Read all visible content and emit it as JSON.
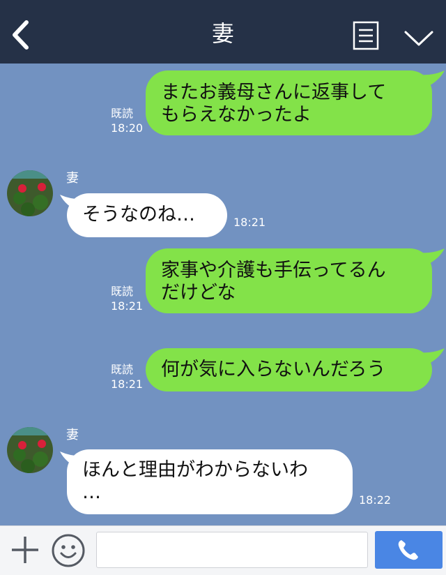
{
  "header": {
    "title": "妻",
    "back_icon": "chevron-left-icon",
    "menu_icon": "note-icon",
    "expand_icon": "chevron-down-icon"
  },
  "colors": {
    "header_bg": "#253147",
    "chat_bg": "#7292c1",
    "sent_bubble": "#83e249",
    "received_bubble": "#ffffff",
    "call_button": "#4a86e4"
  },
  "messages": [
    {
      "direction": "sent",
      "text": "またお義母さんに返事して\nもらえなかったよ",
      "read": "既読",
      "time": "18:20"
    },
    {
      "direction": "received",
      "sender": "妻",
      "text": "そうなのね…",
      "time": "18:21"
    },
    {
      "direction": "sent",
      "text": "家事や介護も手伝ってるん\nだけどな",
      "read": "既読",
      "time": "18:21"
    },
    {
      "direction": "sent",
      "text": "何が気に入らないんだろう",
      "read": "既読",
      "time": "18:21"
    },
    {
      "direction": "received",
      "sender": "妻",
      "text": "ほんと理由がわからないわ\n…",
      "time": "18:22"
    }
  ],
  "footer": {
    "plus_icon": "plus-icon",
    "emoji_icon": "smiley-icon",
    "input_value": "",
    "input_placeholder": "",
    "call_icon": "phone-icon"
  }
}
